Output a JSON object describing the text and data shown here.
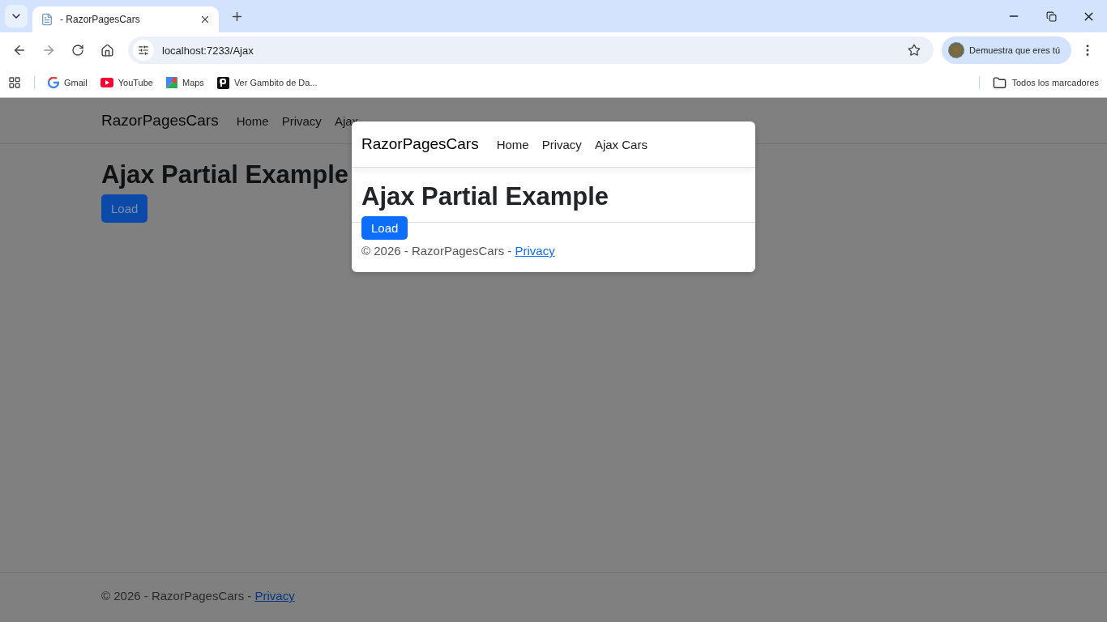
{
  "browser": {
    "tabs": [
      {
        "title": "- RazorPagesCars",
        "selected": true
      }
    ],
    "address": "localhost:7233/Ajax",
    "profile_label": "Demuestra que eres tú",
    "bookmarks": [
      {
        "kind": "google",
        "label": "Gmail"
      },
      {
        "kind": "youtube",
        "label": "YouTube"
      },
      {
        "kind": "maps",
        "label": "Maps"
      },
      {
        "kind": "p",
        "label": "Ver Gambito de Da..."
      }
    ],
    "all_bookmarks": "Todos los marcadores"
  },
  "page": {
    "brand": "RazorPagesCars",
    "nav": [
      "Home",
      "Privacy",
      "Ajax"
    ],
    "heading": "Ajax Partial Example",
    "button": "Load",
    "footer_text": "© 2026 - RazorPagesCars - ",
    "footer_link": "Privacy"
  },
  "modal": {
    "brand": "RazorPagesCars",
    "nav": [
      "Home",
      "Privacy",
      "Ajax Cars"
    ],
    "heading": "Ajax Partial Example",
    "button": "Load",
    "footer_text": "© 2026 - RazorPagesCars - ",
    "footer_link": "Privacy"
  }
}
